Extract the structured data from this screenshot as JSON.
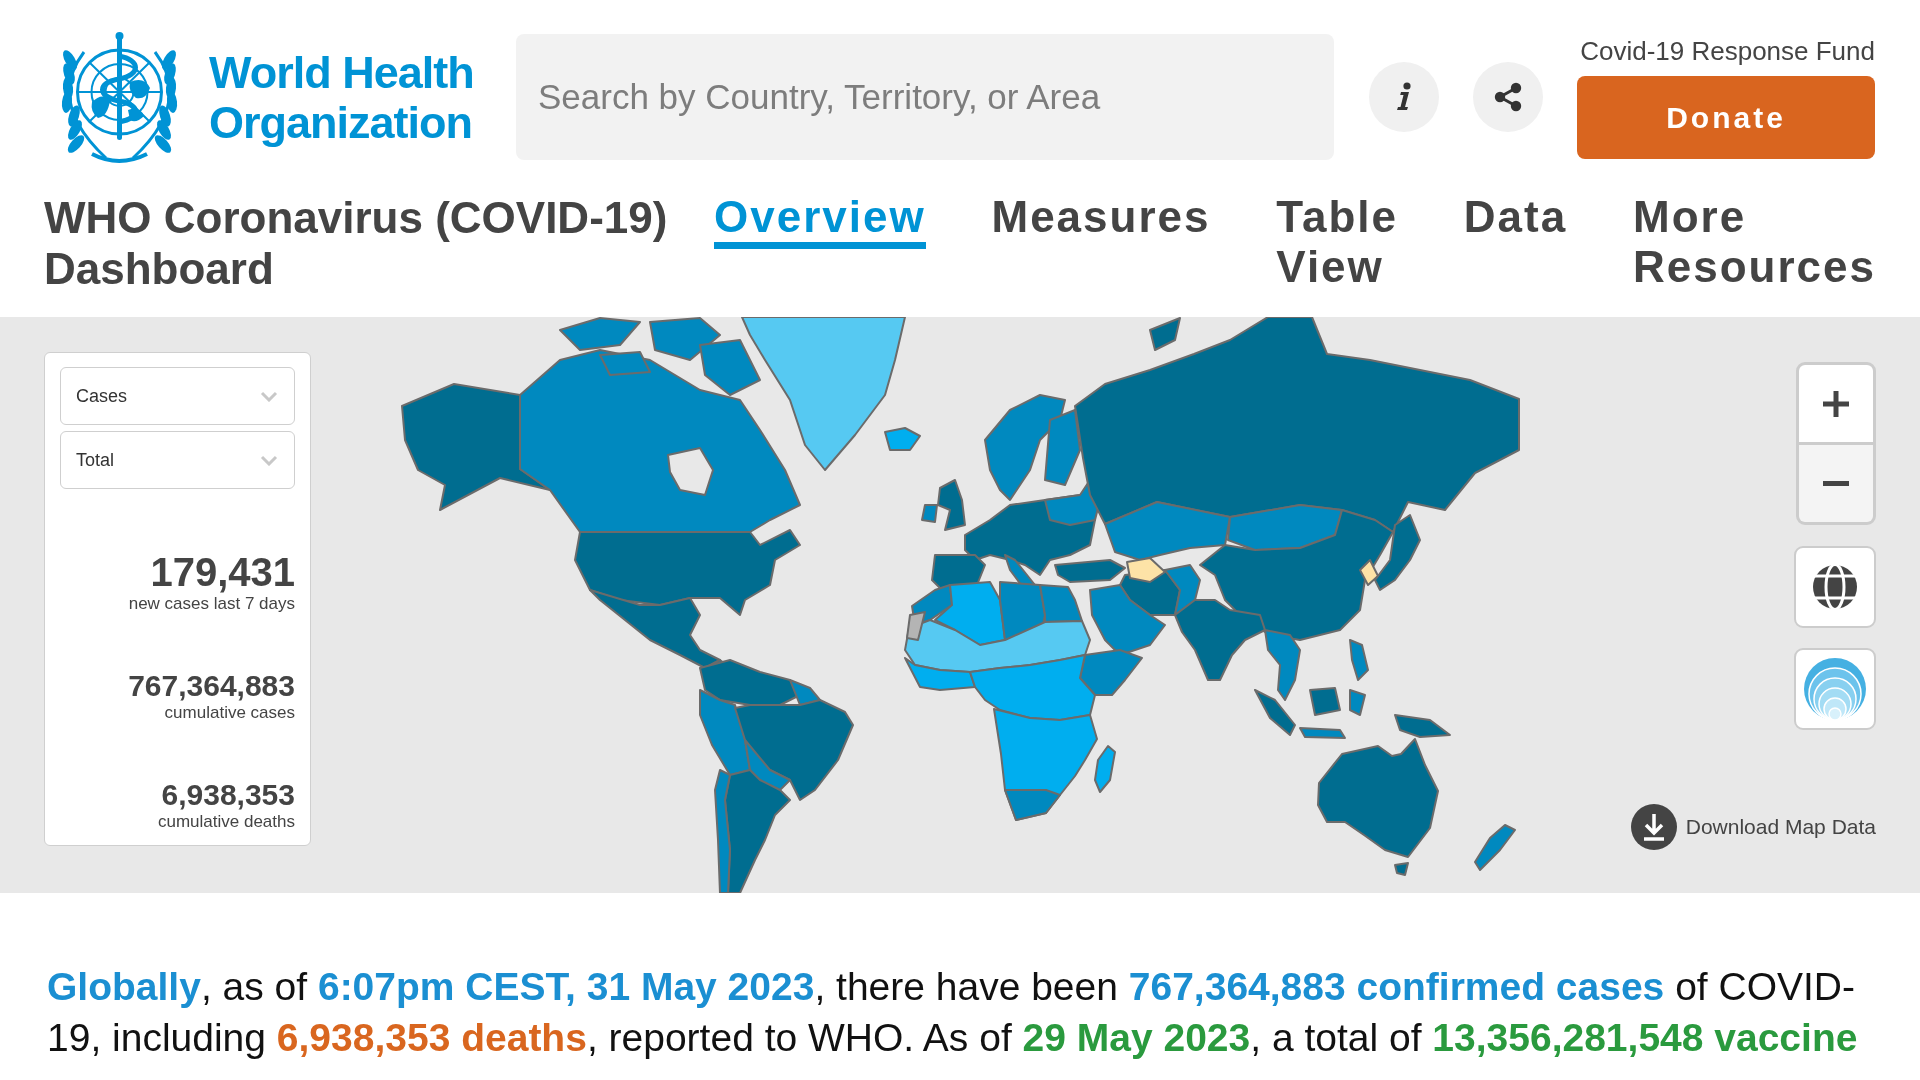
{
  "header": {
    "logo_text": "World Health Organization",
    "search": {
      "placeholder": "Search by Country, Territory, or Area"
    },
    "fund_label": "Covid-19 Response Fund",
    "donate_button": "Donate"
  },
  "dashboard_title": "WHO Coronavirus (COVID-19) Dashboard",
  "nav_tabs": [
    {
      "label": "Overview",
      "selected": true
    },
    {
      "label": "Measures",
      "selected": false
    },
    {
      "label": "Table View",
      "selected": false
    },
    {
      "label": "Data",
      "selected": false
    },
    {
      "label": "More Resources",
      "selected": false
    }
  ],
  "map_panel": {
    "dropdowns": [
      "Cases",
      "Total"
    ],
    "stats": [
      {
        "kind": "headline",
        "value": "179,431",
        "label": "new cases last 7 days"
      },
      {
        "kind": "total",
        "value": "767,364,883",
        "label": "cumulative cases"
      },
      {
        "kind": "total",
        "value": "6,938,353",
        "label": "cumulative deaths"
      }
    ]
  },
  "map_controls": {
    "download_link": "Download Map Data"
  },
  "summary_text": [
    {
      "text": "Globally",
      "color": "#1b8fd2"
    },
    {
      "text": ", as of "
    },
    {
      "text": "6:07pm CEST, 31 May 2023",
      "color": "#1b8fd2"
    },
    {
      "text": ", there have been "
    },
    {
      "text": "767,364,883 confirmed cases",
      "color": "#1b8fd2"
    },
    {
      "text": " of COVID-19, including "
    },
    {
      "text": "6,938,353 deaths",
      "color": "#d9661f"
    },
    {
      "text": ", reported to WHO. As of "
    },
    {
      "text": "29 May 2023",
      "color": "#2a9a3e"
    },
    {
      "text": ", a total of "
    },
    {
      "text": "13,356,281,548 vaccine",
      "color": "#2a9a3e"
    }
  ]
}
